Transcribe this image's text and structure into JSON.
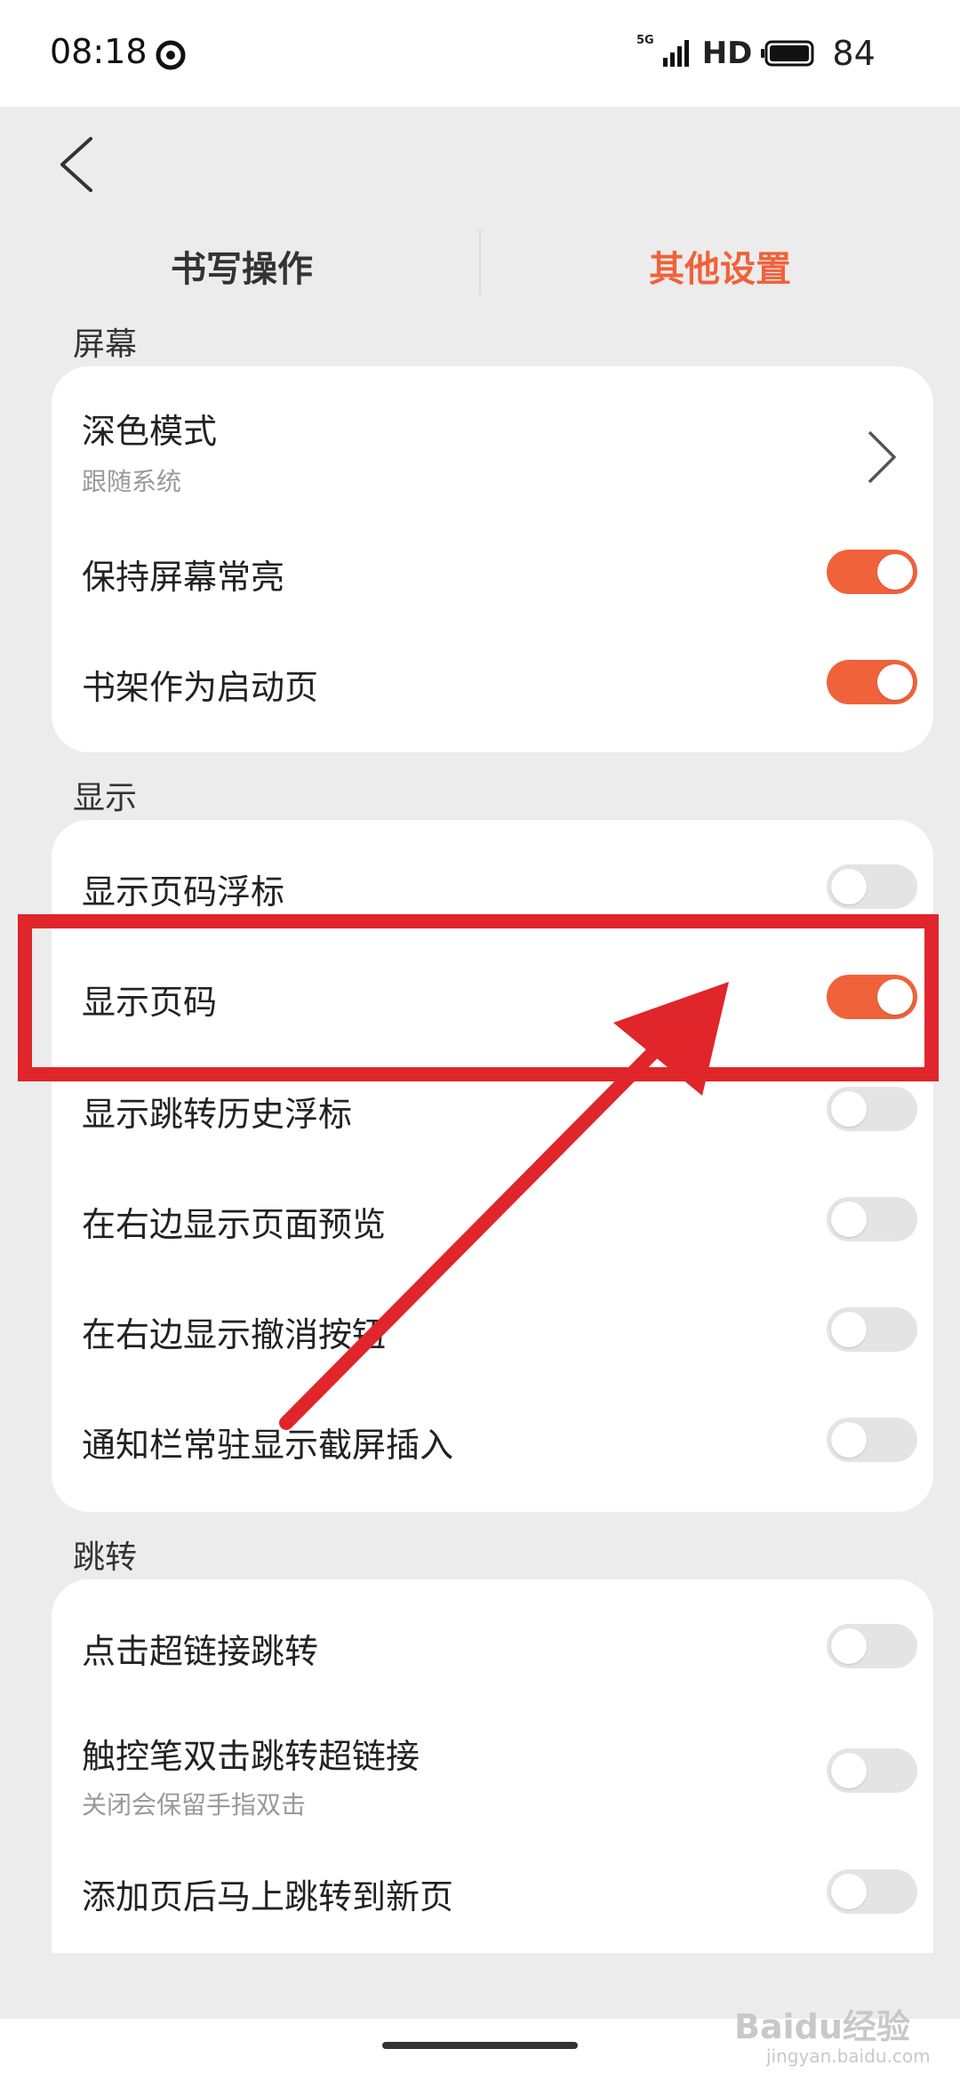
{
  "status_bar": {
    "time": "08:18",
    "network": "5G",
    "hd": "HD",
    "battery": "84"
  },
  "tabs": {
    "writing": "书写操作",
    "other": "其他设置",
    "active_color": "#f0623a"
  },
  "sections": {
    "screen": {
      "header": "屏幕",
      "dark_mode": {
        "label": "深色模式",
        "sub": "跟随系统"
      },
      "keep_awake": {
        "label": "保持屏幕常亮",
        "on": true
      },
      "shelf_start": {
        "label": "书架作为启动页",
        "on": true
      }
    },
    "display": {
      "header": "显示",
      "page_float": {
        "label": "显示页码浮标",
        "on": false
      },
      "page_number": {
        "label": "显示页码",
        "on": true
      },
      "jump_history_float": {
        "label": "显示跳转历史浮标",
        "on": false
      },
      "right_preview": {
        "label": "在右边显示页面预览",
        "on": false
      },
      "right_undo": {
        "label": "在右边显示撤消按钮",
        "on": false
      },
      "notif_screenshot": {
        "label": "通知栏常驻显示截屏插入",
        "on": false
      }
    },
    "jump": {
      "header": "跳转",
      "hyperlink_click": {
        "label": "点击超链接跳转",
        "on": false
      },
      "stylus_double": {
        "label": "触控笔双击跳转超链接",
        "sub": "关闭会保留手指双击",
        "on": false
      },
      "add_page_jump": {
        "label": "添加页后马上跳转到新页",
        "on": false
      }
    }
  },
  "watermark": {
    "brand": "Baidu经验",
    "url": "jingyan.baidu.com"
  },
  "colors": {
    "accent": "#f0623a",
    "annotation": "#e0252b"
  }
}
